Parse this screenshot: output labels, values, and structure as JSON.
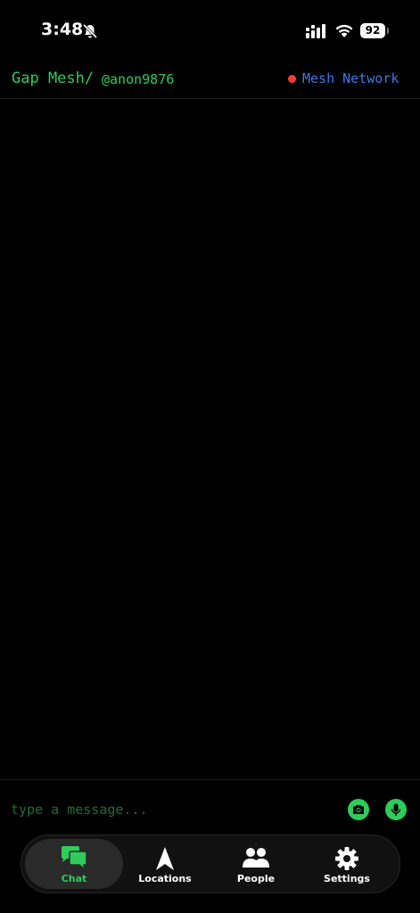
{
  "status_bar": {
    "time": "3:48",
    "battery": "92"
  },
  "header": {
    "title": "Gap Mesh/",
    "username": "@anon9876",
    "network_label": "Mesh Network",
    "network_status_color": "#ff3b30"
  },
  "composer": {
    "placeholder": "type a message..."
  },
  "tabs": [
    {
      "label": "Chat",
      "icon": "chat-bubbles-icon",
      "active": true
    },
    {
      "label": "Locations",
      "icon": "location-arrow-icon",
      "active": false
    },
    {
      "label": "People",
      "icon": "people-icon",
      "active": false
    },
    {
      "label": "Settings",
      "icon": "gear-icon",
      "active": false
    }
  ],
  "colors": {
    "accent": "#2ecc5b",
    "network_blue": "#3f78e0",
    "background": "#000000"
  }
}
